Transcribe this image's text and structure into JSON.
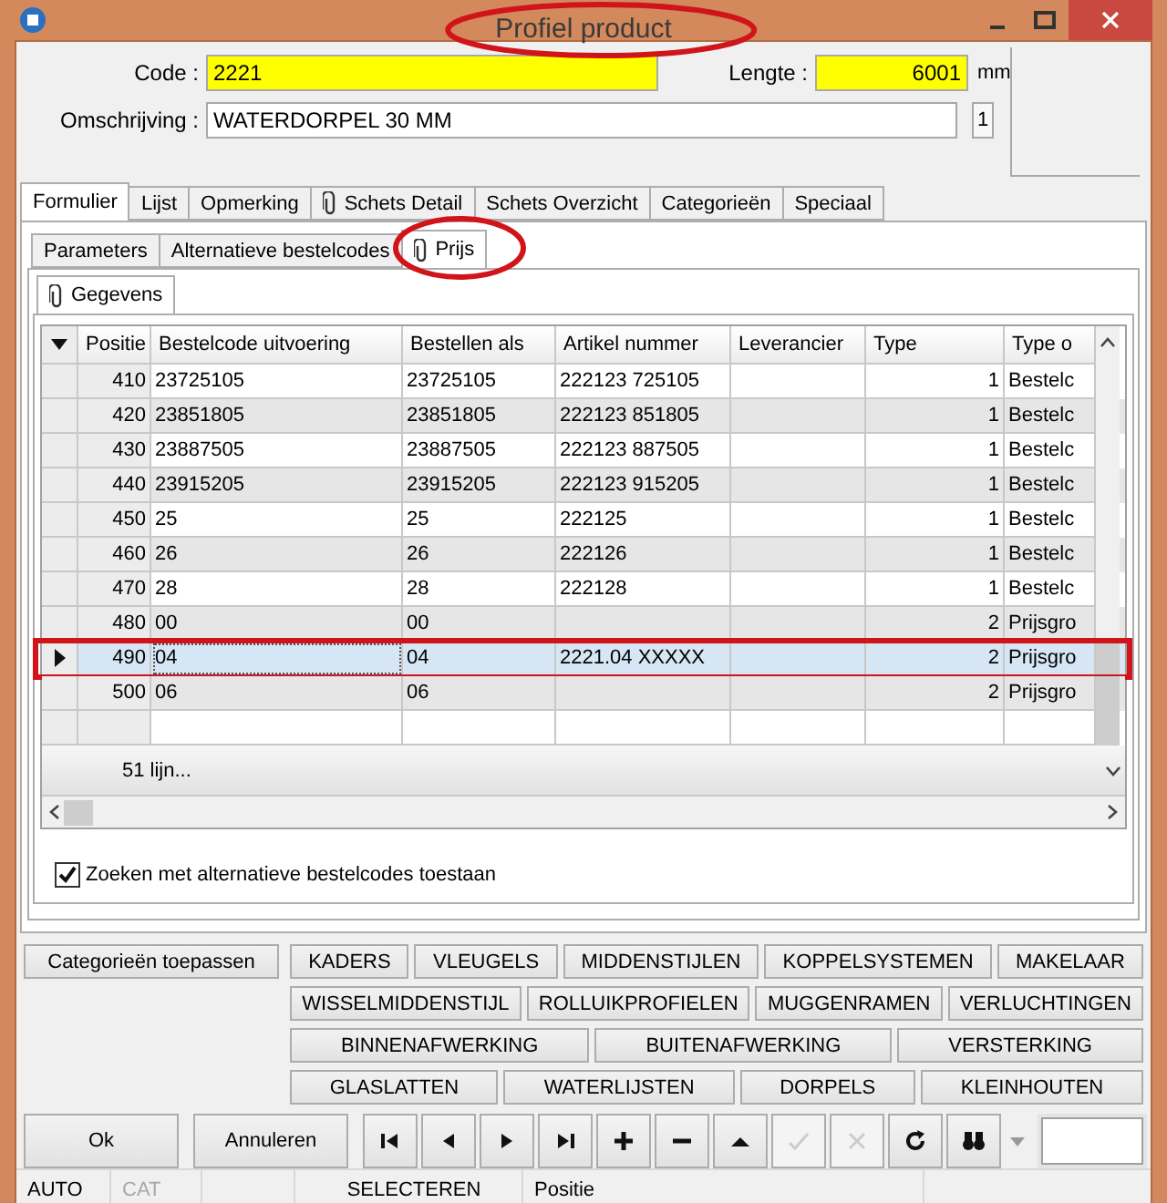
{
  "window": {
    "title": "Profiel product"
  },
  "form": {
    "code_label": "Code :",
    "code": "2221",
    "length_label": "Lengte :",
    "length": "6001",
    "unit": "mm",
    "description_label": "Omschrijving :",
    "description": "WATERDORPEL 30 MM",
    "side_value": "1"
  },
  "tabs": [
    {
      "label": "Formulier",
      "selected": true,
      "clip": false
    },
    {
      "label": "Lijst",
      "selected": false,
      "clip": false
    },
    {
      "label": "Opmerking",
      "selected": false,
      "clip": false
    },
    {
      "label": "Schets Detail",
      "selected": false,
      "clip": true
    },
    {
      "label": "Schets Overzicht",
      "selected": false,
      "clip": false
    },
    {
      "label": "Categorieën",
      "selected": false,
      "clip": false
    },
    {
      "label": "Speciaal",
      "selected": false,
      "clip": false
    }
  ],
  "subtabs": [
    {
      "label": "Parameters",
      "selected": false,
      "clip": false
    },
    {
      "label": "Alternatieve bestelcodes",
      "selected": false,
      "clip": false
    },
    {
      "label": "Prijs",
      "selected": true,
      "clip": true
    }
  ],
  "inner_tab": {
    "label": "Gegevens"
  },
  "table": {
    "columns": [
      "Positie",
      "Bestelcode uitvoering",
      "Bestellen als",
      "Artikel nummer",
      "Leverancier",
      "Type",
      "Type o"
    ],
    "rows": [
      {
        "cells": [
          "410",
          "23725105",
          "23725105",
          "222123 725105",
          "",
          "1",
          "Bestelc"
        ],
        "selected": false
      },
      {
        "cells": [
          "420",
          "23851805",
          "23851805",
          "222123 851805",
          "",
          "1",
          "Bestelc"
        ],
        "selected": false
      },
      {
        "cells": [
          "430",
          "23887505",
          "23887505",
          "222123 887505",
          "",
          "1",
          "Bestelc"
        ],
        "selected": false
      },
      {
        "cells": [
          "440",
          "23915205",
          "23915205",
          "222123 915205",
          "",
          "1",
          "Bestelc"
        ],
        "selected": false
      },
      {
        "cells": [
          "450",
          "25",
          "25",
          "222125",
          "",
          "1",
          "Bestelc"
        ],
        "selected": false
      },
      {
        "cells": [
          "460",
          "26",
          "26",
          "222126",
          "",
          "1",
          "Bestelc"
        ],
        "selected": false
      },
      {
        "cells": [
          "470",
          "28",
          "28",
          "222128",
          "",
          "1",
          "Bestelc"
        ],
        "selected": false
      },
      {
        "cells": [
          "480",
          "00",
          "00",
          "",
          "",
          "2",
          "Prijsgro"
        ],
        "selected": false
      },
      {
        "cells": [
          "490",
          "04",
          "04",
          "2221.04 XXXXX",
          "",
          "2",
          "Prijsgro"
        ],
        "selected": true
      },
      {
        "cells": [
          "500",
          "06",
          "06",
          "",
          "",
          "2",
          "Prijsgro"
        ],
        "selected": false
      },
      {
        "cells": [
          "",
          "",
          "",
          "",
          "",
          "",
          ""
        ],
        "selected": false
      }
    ],
    "footer": "51 lijn..."
  },
  "checkbox": {
    "label": "Zoeken met alternatieve bestelcodes toestaan",
    "checked": true
  },
  "apply_button": "Categorieën toepassen",
  "category_rows": [
    [
      "KADERS",
      "VLEUGELS",
      "MIDDENSTIJLEN",
      "KOPPELSYSTEMEN",
      "MAKELAAR"
    ],
    [
      "WISSELMIDDENSTIJL",
      "ROLLUIKPROFIELEN",
      "MUGGENRAMEN",
      "VERLUCHTINGEN"
    ],
    [
      "BINNENAFWERKING",
      "BUITENAFWERKING",
      "VERSTERKING"
    ],
    [
      "GLASLATTEN",
      "WATERLIJSTEN",
      "DORPELS",
      "KLEINHOUTEN"
    ]
  ],
  "buttons": {
    "ok": "Ok",
    "cancel": "Annuleren"
  },
  "nav": [
    {
      "kind": "first",
      "disabled": false
    },
    {
      "kind": "prev",
      "disabled": false
    },
    {
      "kind": "next",
      "disabled": false
    },
    {
      "kind": "last",
      "disabled": false
    },
    {
      "kind": "add",
      "disabled": false
    },
    {
      "kind": "remove",
      "disabled": false
    },
    {
      "kind": "up",
      "disabled": false
    },
    {
      "kind": "confirm",
      "disabled": true
    },
    {
      "kind": "cancel",
      "disabled": true
    },
    {
      "kind": "refresh",
      "disabled": false
    },
    {
      "kind": "find",
      "disabled": false
    }
  ],
  "status_bar": [
    {
      "text": "AUTO",
      "disabled": false
    },
    {
      "text": "CAT",
      "disabled": true
    },
    {
      "text": "SELECTEREN",
      "disabled": false
    },
    {
      "text": "Positie",
      "disabled": false
    }
  ]
}
